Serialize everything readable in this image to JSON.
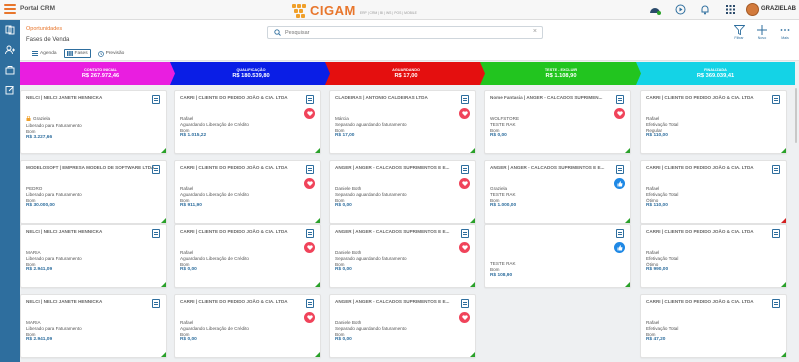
{
  "app": {
    "portal_title": "Portal CRM",
    "logo_text": "CIGAM",
    "logo_sub": "ERP | CRM | BI | WS | POS | MOBILE",
    "user_name": "GRAZIELAB"
  },
  "header": {
    "breadcrumb": "Oportunidades",
    "page_title": "Fases de Venda",
    "search_placeholder": "Pesquisar",
    "views": [
      {
        "label": "Agenda"
      },
      {
        "label": "Fases"
      },
      {
        "label": "Previsão"
      }
    ],
    "actions": [
      {
        "label": "Filtrar"
      },
      {
        "label": "Novo"
      },
      {
        "label": "Mais"
      }
    ]
  },
  "stages": [
    {
      "name": "CONTATO INICIAL",
      "total": "R$ 267.972,46",
      "color": "#e91ee0"
    },
    {
      "name": "QUALIFICAÇÃO",
      "total": "R$ 180.539,80",
      "color": "#0a1ee6"
    },
    {
      "name": "AGUARDANDO",
      "total": "R$ 17,00",
      "color": "#e40f0f"
    },
    {
      "name": "TESTE - EXCLUIR",
      "total": "R$ 1.108,90",
      "color": "#22c51f"
    },
    {
      "name": "FINALIZADA",
      "total": "R$ 369.039,41",
      "color": "#14d3e6"
    }
  ],
  "columns": [
    [
      {
        "title": "NELCI | NELCI JANETE HENNICKA",
        "lines": [
          "Graziela",
          "Liberado para Faturamento",
          "Bom"
        ],
        "value": "R$ 3.227,66",
        "badge": "none",
        "corner": "green",
        "lock": true
      },
      {
        "title": "MODELOSOFT | EMPRESA MODELO DE SOFTWARE LTDA",
        "lines": [
          "PEDRO",
          "Liberado para Faturamento",
          "Bom"
        ],
        "value": "R$ 30.000,00",
        "badge": "none",
        "corner": "green"
      },
      {
        "title": "NELCI | NELCI JANETE HENNICKA",
        "lines": [
          "MARIA",
          "Liberado para Faturamento",
          "Bom"
        ],
        "value": "R$ 2.941,09",
        "badge": "none",
        "corner": "green"
      },
      {
        "title": "NELCI | NELCI JANETE HENNICKA",
        "lines": [
          "MARIA",
          "Liberado para Faturamento",
          "Bom"
        ],
        "value": "R$ 2.941,09",
        "badge": "none",
        "corner": "green"
      }
    ],
    [
      {
        "title": "CARRI | CLIENTE DO PEDIDO JOÃO & CIA. LTDA",
        "lines": [
          "Rafael",
          "Aguardando Liberação de Crédito",
          "Bom"
        ],
        "value": "R$ 1.015,22",
        "badge": "red",
        "corner": "green"
      },
      {
        "title": "CARRI | CLIENTE DO PEDIDO JOÃO & CIA. LTDA",
        "lines": [
          "Rafael",
          "Aguardando Liberação de Crédito",
          "Bom"
        ],
        "value": "R$ 911,90",
        "badge": "red",
        "corner": "green"
      },
      {
        "title": "CARRI | CLIENTE DO PEDIDO JOÃO & CIA. LTDA",
        "lines": [
          "Rafael",
          "Aguardando Liberação de Crédito",
          "Bom"
        ],
        "value": "R$ 0,00",
        "badge": "red",
        "corner": "green"
      },
      {
        "title": "CARRI | CLIENTE DO PEDIDO JOÃO & CIA. LTDA",
        "lines": [
          "Rafael",
          "Aguardando Liberação de Crédito",
          "Bom"
        ],
        "value": "R$ 0,00",
        "badge": "red",
        "corner": "green"
      }
    ],
    [
      {
        "title": "CLADEIRAS | ANTONIO CALDEIRAS LTDA",
        "lines": [
          "Márcia",
          "Separado aguardando faturamento",
          "Bom"
        ],
        "value": "R$ 17,00",
        "badge": "red",
        "corner": "green"
      },
      {
        "title": "ANGER | ANGER - CALCADOS SUPRIMENTOS E E...",
        "lines": [
          "Daniele Both",
          "Separado aguardando faturamento",
          "Bom"
        ],
        "value": "R$ 0,00",
        "badge": "red",
        "corner": "green"
      },
      {
        "title": "ANGER | ANGER - CALCADOS SUPRIMENTOS E E...",
        "lines": [
          "Daniele Both",
          "Separado aguardando faturamento",
          "Bom"
        ],
        "value": "R$ 0,00",
        "badge": "red",
        "corner": "green"
      },
      {
        "title": "ANGER | ANGER - CALCADOS SUPRIMENTOS E E...",
        "lines": [
          "Daniele Both",
          "Separado aguardando faturamento",
          "Bom"
        ],
        "value": "R$ 0,00",
        "badge": "red",
        "corner": "green"
      }
    ],
    [
      {
        "title": "Nome Fantasia | ANGER - CALCADOS SUPRIMEN...",
        "lines": [
          "WOLFSTORE",
          "TESTE RAK",
          "Bom"
        ],
        "value": "R$ 0,00",
        "badge": "red",
        "corner": "green"
      },
      {
        "title": "ANGER | ANGER - CALCADOS SUPRIMENTOS E E...",
        "lines": [
          "Graziela",
          "TESTE RAK",
          "Bom"
        ],
        "value": "R$ 1.000,00",
        "badge": "blue",
        "corner": "green"
      },
      {
        "title": "",
        "lines": [
          "TESTE RAK",
          "Bom"
        ],
        "value": "R$ 108,90",
        "badge": "blue",
        "corner": "green"
      }
    ],
    [
      {
        "title": "CARRI | CLIENTE DO PEDIDO JOÃO & CIA. LTDA",
        "lines": [
          "Rafael",
          "Efetivação Total",
          "Regular"
        ],
        "value": "R$ 110,00",
        "badge": "none",
        "corner": "green"
      },
      {
        "title": "CARRI | CLIENTE DO PEDIDO JOÃO & CIA. LTDA",
        "lines": [
          "Rafael",
          "Efetivação Total",
          "Ótimo"
        ],
        "value": "R$ 110,00",
        "badge": "none",
        "corner": "red"
      },
      {
        "title": "CARRI | CLIENTE DO PEDIDO JOÃO & CIA. LTDA",
        "lines": [
          "Rafael",
          "Efetivação Total",
          "Ótimo"
        ],
        "value": "R$ 990,00",
        "badge": "none",
        "corner": "green"
      },
      {
        "title": "CARRI | CLIENTE DO PEDIDO JOÃO & CIA. LTDA",
        "lines": [
          "Rafael",
          "Efetivação Total",
          "Bom"
        ],
        "value": "R$ 47,20",
        "badge": "none",
        "corner": "green"
      }
    ]
  ]
}
